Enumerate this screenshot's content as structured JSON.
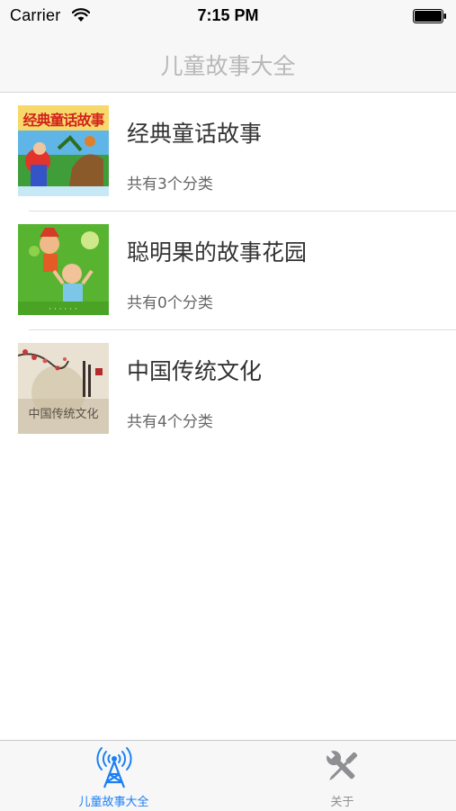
{
  "status_bar": {
    "carrier": "Carrier",
    "time": "7:15 PM"
  },
  "nav": {
    "title": "儿童故事大全"
  },
  "list": {
    "items": [
      {
        "title": "经典童话故事",
        "subtitle": "共有3个分类",
        "thumb_text": "经典童话故事",
        "thumb_icon": "fairy-tale-cover-icon"
      },
      {
        "title": "聪明果的故事花园",
        "subtitle": "共有0个分类",
        "thumb_text": "",
        "thumb_icon": "story-garden-cover-icon"
      },
      {
        "title": "中国传统文化",
        "subtitle": "共有4个分类",
        "thumb_text": "中国传统文化",
        "thumb_icon": "chinese-culture-cover-icon"
      }
    ]
  },
  "tabs": [
    {
      "label": "儿童故事大全",
      "icon": "radio-tower-icon",
      "active": true
    },
    {
      "label": "关于",
      "icon": "tools-icon",
      "active": false
    }
  ],
  "colors": {
    "tab_active": "#1a7ff5",
    "tab_inactive": "#8e8e93",
    "nav_title": "#b8b8b8"
  }
}
